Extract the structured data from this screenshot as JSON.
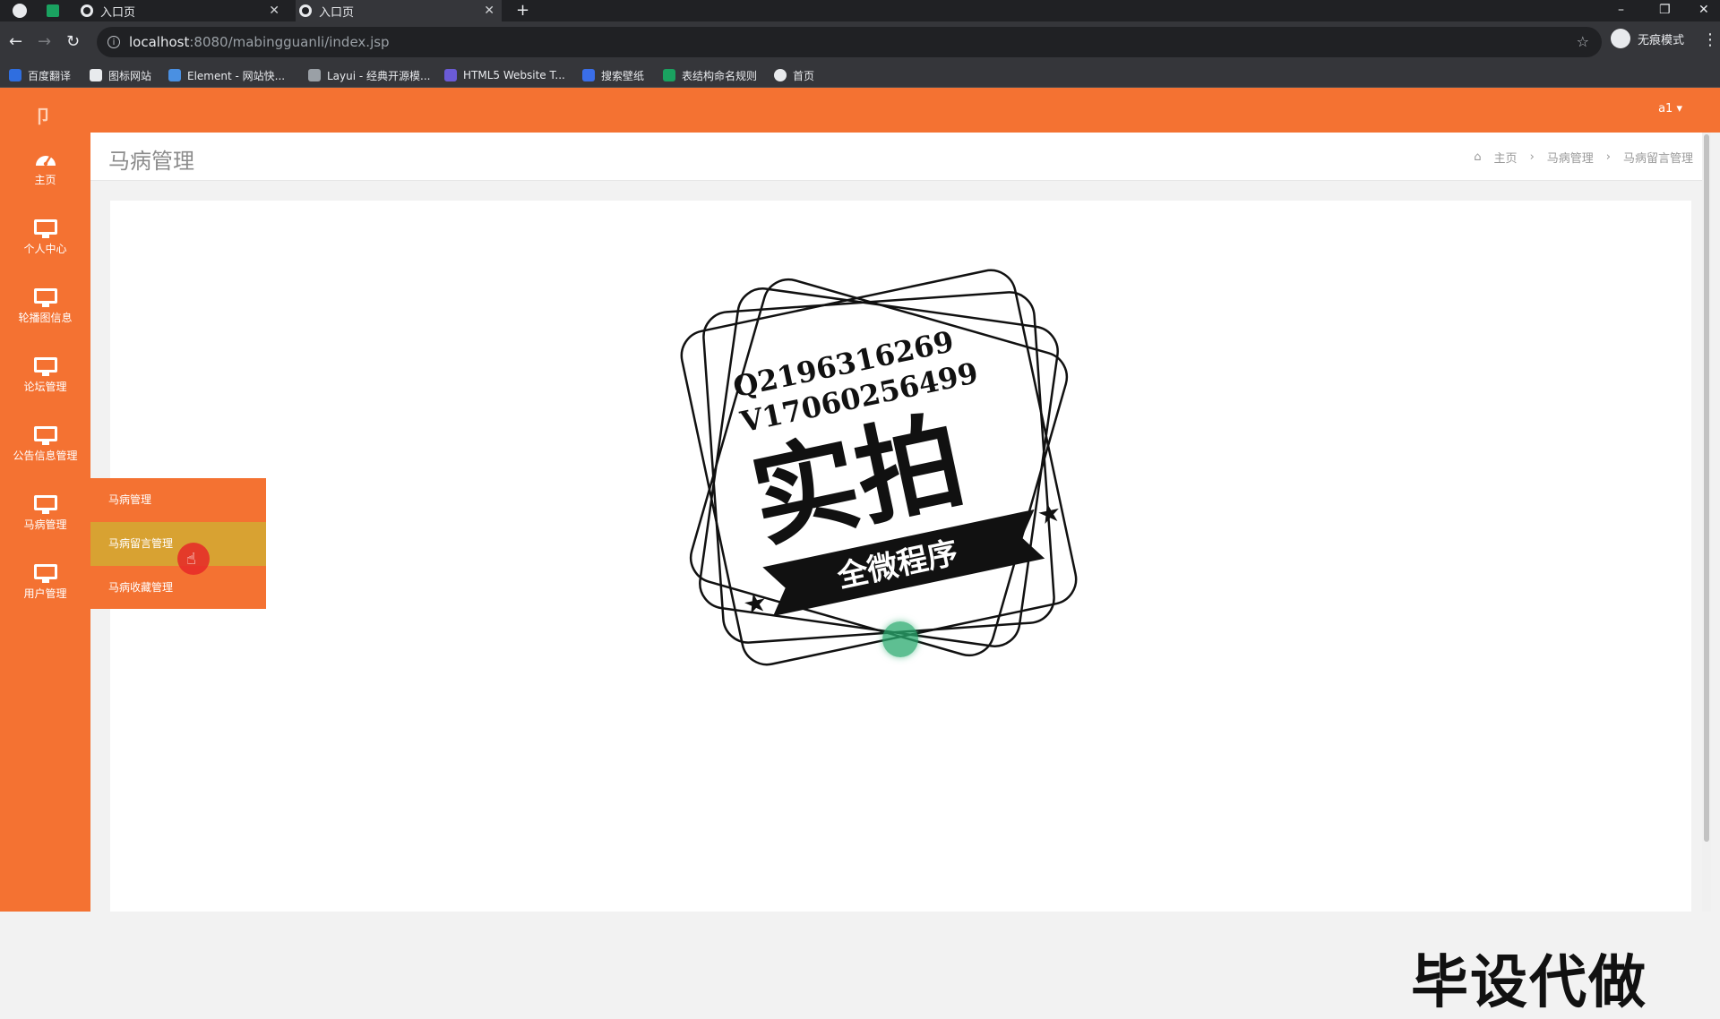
{
  "browser": {
    "tabs": [
      {
        "label": "入口页"
      },
      {
        "label": "入口页"
      }
    ],
    "url_host": "localhost",
    "url_path": ":8080/mabingguanli/index.jsp",
    "profile_label": "无痕模式",
    "bookmarks": [
      {
        "label": "百度翻译",
        "color": "#2f6ee0"
      },
      {
        "label": "图标网站",
        "color": "#e8eaed"
      },
      {
        "label": "Element - 网站快...",
        "color": "#4a90e2"
      },
      {
        "label": "Layui - 经典开源模...",
        "color": "#9aa0a6"
      },
      {
        "label": "HTML5 Website T...",
        "color": "#6b5bd6"
      },
      {
        "label": "搜索壁纸",
        "color": "#3a6ee8"
      },
      {
        "label": "表结构命名规则",
        "color": "#1aa260"
      },
      {
        "label": "首页",
        "color": "#e8eaed"
      }
    ]
  },
  "app": {
    "user_label": "a1 ▾",
    "sidebar": [
      {
        "label": "主页",
        "icon": "dashboard-icon"
      },
      {
        "label": "个人中心",
        "icon": "monitor-icon"
      },
      {
        "label": "轮播图信息",
        "icon": "monitor-icon"
      },
      {
        "label": "论坛管理",
        "icon": "monitor-icon"
      },
      {
        "label": "公告信息管理",
        "icon": "monitor-icon"
      },
      {
        "label": "马病管理",
        "icon": "monitor-icon"
      },
      {
        "label": "用户管理",
        "icon": "monitor-icon"
      }
    ],
    "submenu": [
      {
        "label": "马病管理"
      },
      {
        "label": "马病留言管理"
      },
      {
        "label": "马病收藏管理"
      }
    ],
    "page_title": "马病管理",
    "breadcrumb": [
      "主页",
      "马病管理",
      "马病留言管理"
    ],
    "stamp": {
      "line1": "Q2196316269",
      "line2": "V17060256499",
      "big": "实拍",
      "banner": "全微程序"
    },
    "watermark": "毕设代做"
  }
}
